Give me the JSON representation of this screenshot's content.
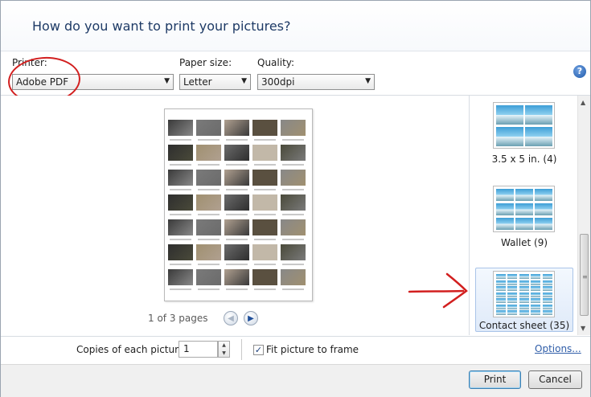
{
  "dialog": {
    "title": "How do you want to print your pictures?"
  },
  "controls": {
    "printer_label": "Printer:",
    "printer_value": "Adobe PDF",
    "paper_label": "Paper size:",
    "paper_value": "Letter",
    "quality_label": "Quality:",
    "quality_value": "300dpi",
    "help_glyph": "?"
  },
  "preview": {
    "page_info": "1 of 3 pages",
    "thumbnail_count": 35
  },
  "layouts": [
    {
      "label": "3.5 x 5 in. (4)"
    },
    {
      "label": "Wallet (9)"
    },
    {
      "label": "Contact sheet (35)",
      "selected": true
    }
  ],
  "copies": {
    "label": "Copies of each picture:",
    "value": "1"
  },
  "fit": {
    "label": "Fit picture to frame",
    "checked": true
  },
  "options_link": "Options...",
  "buttons": {
    "print": "Print",
    "cancel": "Cancel"
  },
  "colors": {
    "annotation_red": "#d21f1f",
    "title_blue": "#1e3a66",
    "link_blue": "#2f5da8"
  }
}
